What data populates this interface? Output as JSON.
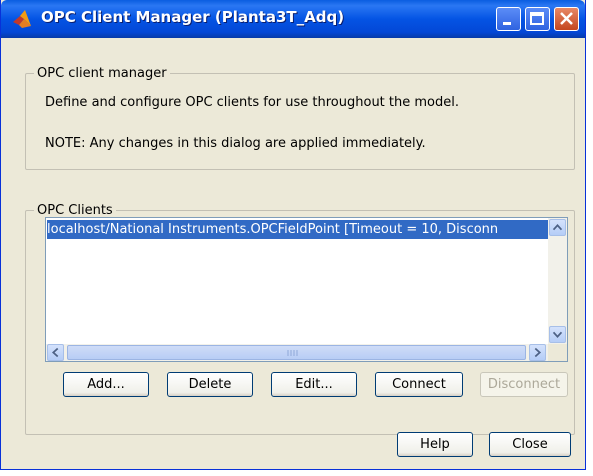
{
  "window": {
    "title": "OPC Client Manager (Planta3T_Adq)"
  },
  "manager_group": {
    "legend": "OPC client manager",
    "description": "Define and configure OPC clients for use throughout the model.",
    "note": "NOTE: Any changes in this dialog are applied immediately."
  },
  "clients_group": {
    "legend": "OPC Clients",
    "items": [
      "localhost/National Instruments.OPCFieldPoint [Timeout = 10, Disconn"
    ]
  },
  "buttons": {
    "add": "Add...",
    "delete": "Delete",
    "edit": "Edit...",
    "connect": "Connect",
    "disconnect": "Disconnect",
    "help": "Help",
    "close": "Close"
  },
  "colors": {
    "titlebar": "#0454e4",
    "selection": "#316ac5",
    "dialog_bg": "#ece9d8"
  }
}
